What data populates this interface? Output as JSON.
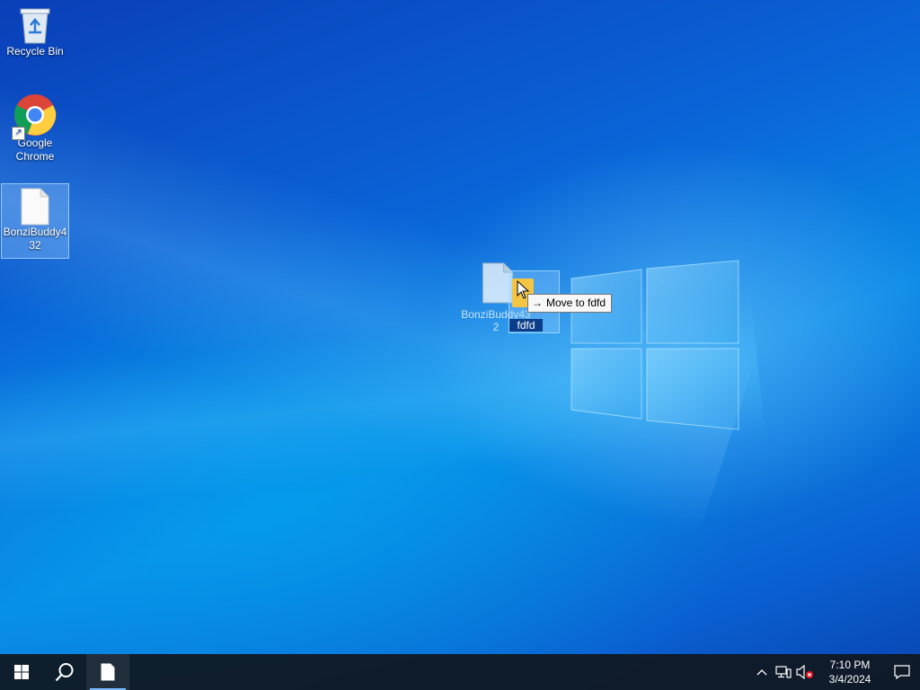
{
  "desktop": {
    "icons": [
      {
        "label": "Recycle Bin",
        "icon": "recycle-bin-icon"
      },
      {
        "label": "Google Chrome",
        "icon": "chrome-icon"
      },
      {
        "label": "BonziBuddy432",
        "icon": "text-file-icon"
      }
    ],
    "drag": {
      "file_label": "BonziBuddy432",
      "target_folder": "fdfd",
      "tooltip_arrow": "→",
      "tooltip_text": "Move to fdfd"
    }
  },
  "taskbar": {
    "start_icon": "windows-start-icon",
    "search_icon": "search-icon",
    "active_app_icon": "text-file-icon",
    "tray": {
      "overflow_icon": "chevron-up-icon",
      "network_icon": "network-icon",
      "volume_icon": "volume-muted-icon",
      "time": "7:10 PM",
      "date": "3/4/2024",
      "notification_icon": "action-center-icon"
    }
  },
  "colors": {
    "taskbar_bg": "#10181f",
    "accent": "#7ab8ff",
    "folder": "#f4c542"
  }
}
